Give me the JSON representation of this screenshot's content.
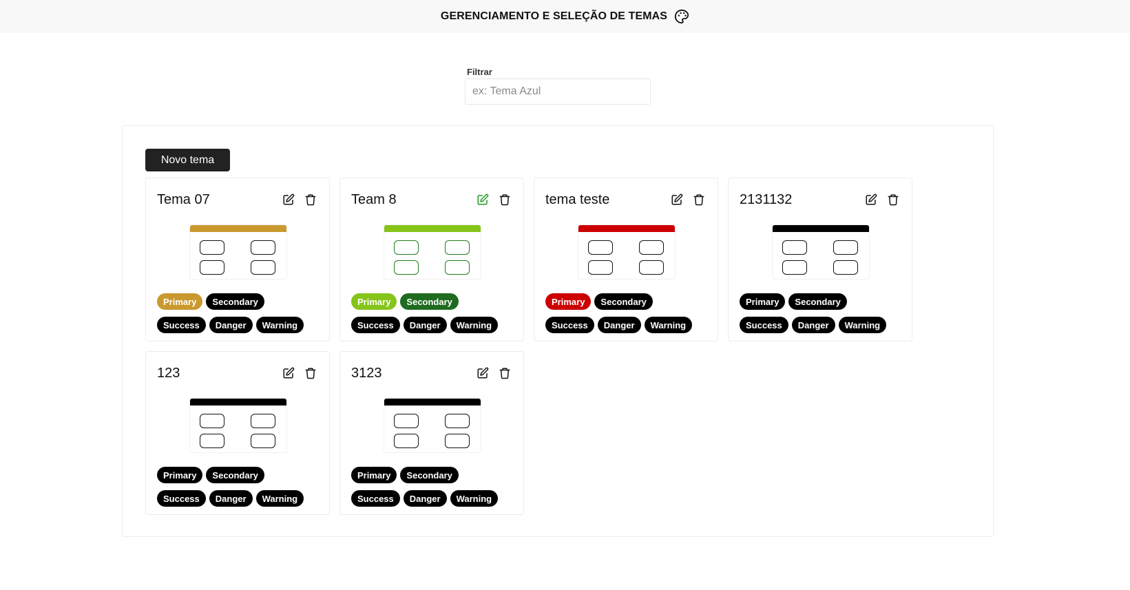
{
  "header": {
    "title": "GERENCIAMENTO E SELEÇÃO DE TEMAS",
    "icon": "palette-icon"
  },
  "filter": {
    "label": "Filtrar",
    "placeholder": "ex: Tema Azul",
    "value": ""
  },
  "panel": {
    "new_button_label": "Novo tema"
  },
  "badge_labels": {
    "primary": "Primary",
    "secondary": "Secondary",
    "success": "Success",
    "danger": "Danger",
    "warning": "Warning"
  },
  "themes": [
    {
      "name": "Tema 07",
      "edit_icon": "edit-icon",
      "delete_icon": "trash-icon",
      "primary_color": "#c9992e",
      "secondary_color": "#000000",
      "success_color": "#000000",
      "danger_color": "#000000",
      "warning_color": "#000000",
      "box_color": "#111111",
      "edit_icon_color": "#111111"
    },
    {
      "name": "Team 8",
      "edit_icon": "edit-icon",
      "delete_icon": "trash-icon",
      "primary_color": "#86c41a",
      "secondary_color": "#1f6b1f",
      "success_color": "#000000",
      "danger_color": "#000000",
      "warning_color": "#000000",
      "box_color": "#1f7a1f",
      "edit_icon_color": "#1f9a1f"
    },
    {
      "name": "tema teste",
      "edit_icon": "edit-icon",
      "delete_icon": "trash-icon",
      "primary_color": "#cc0000",
      "secondary_color": "#000000",
      "success_color": "#000000",
      "danger_color": "#000000",
      "warning_color": "#000000",
      "box_color": "#111111",
      "edit_icon_color": "#111111"
    },
    {
      "name": "2131132",
      "edit_icon": "edit-icon",
      "delete_icon": "trash-icon",
      "primary_color": "#000000",
      "secondary_color": "#000000",
      "success_color": "#000000",
      "danger_color": "#000000",
      "warning_color": "#000000",
      "box_color": "#111111",
      "edit_icon_color": "#111111"
    },
    {
      "name": "123",
      "edit_icon": "edit-icon",
      "delete_icon": "trash-icon",
      "primary_color": "#000000",
      "secondary_color": "#000000",
      "success_color": "#000000",
      "danger_color": "#000000",
      "warning_color": "#000000",
      "box_color": "#111111",
      "edit_icon_color": "#111111"
    },
    {
      "name": "3123",
      "edit_icon": "edit-icon",
      "delete_icon": "trash-icon",
      "primary_color": "#000000",
      "secondary_color": "#000000",
      "success_color": "#000000",
      "danger_color": "#000000",
      "warning_color": "#000000",
      "box_color": "#111111",
      "edit_icon_color": "#111111"
    }
  ]
}
